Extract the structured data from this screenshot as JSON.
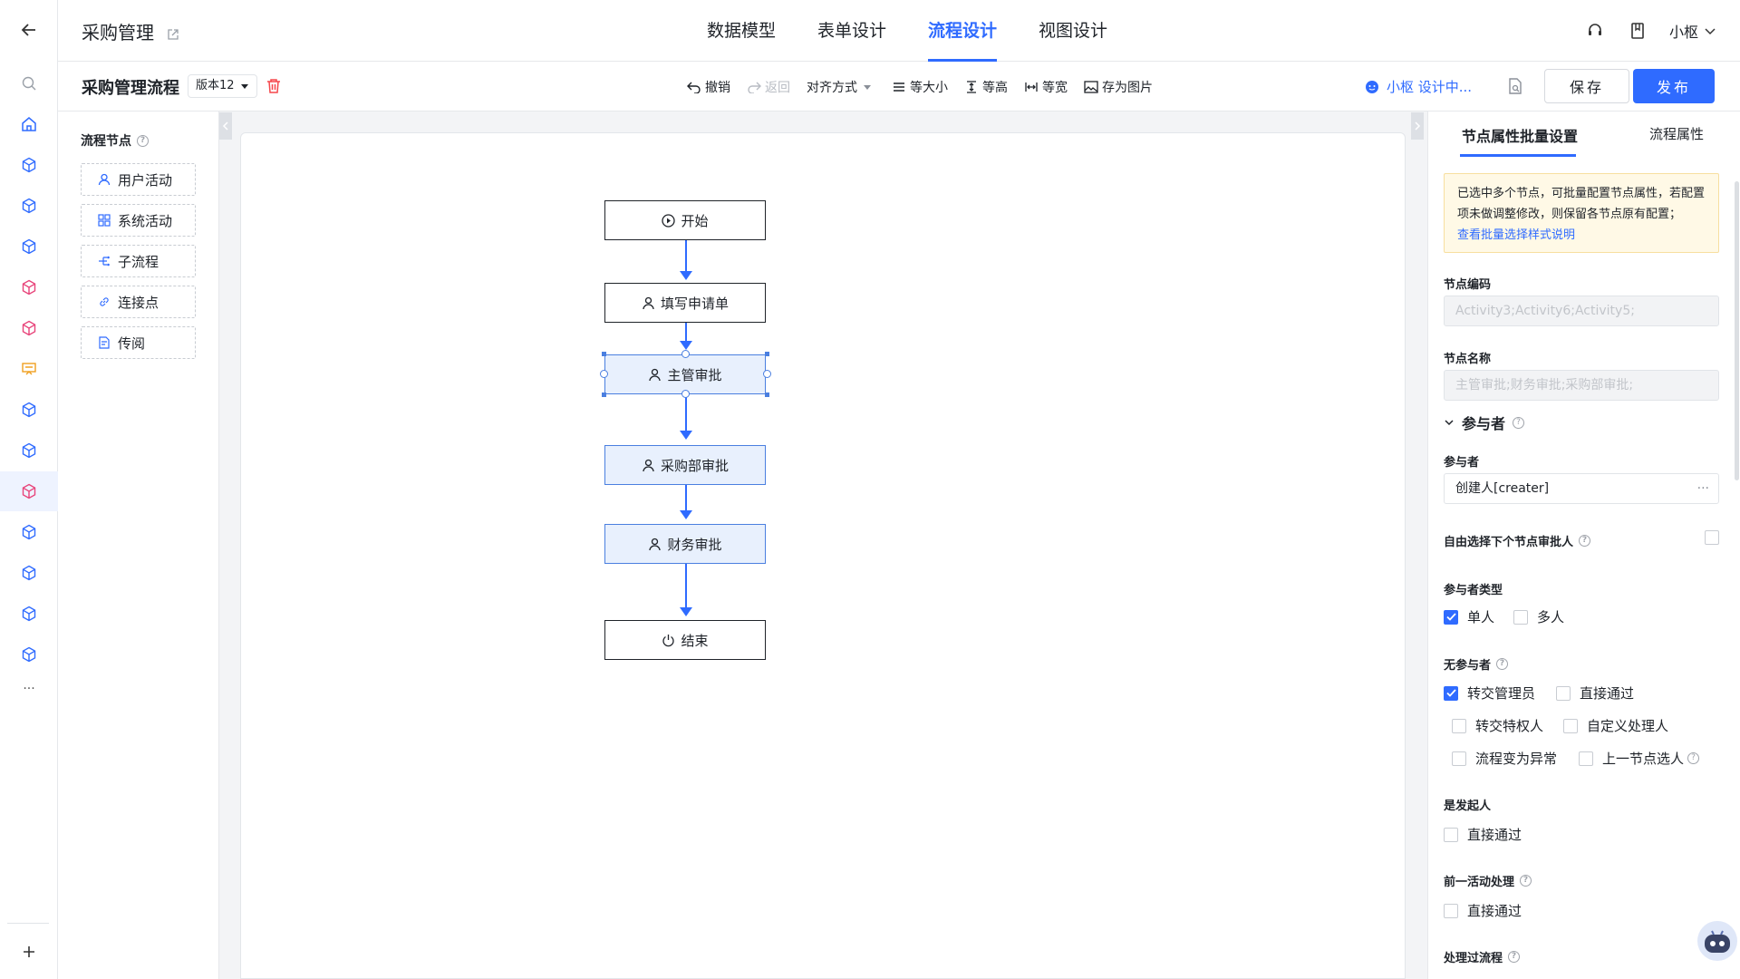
{
  "app": {
    "title": "采购管理"
  },
  "nav_tabs": [
    {
      "label": "数据模型"
    },
    {
      "label": "表单设计"
    },
    {
      "label": "流程设计"
    },
    {
      "label": "视图设计"
    }
  ],
  "user": {
    "name": "小枢"
  },
  "toolbar": {
    "process_name": "采购管理流程",
    "version": "版本12",
    "undo": "撤销",
    "redo": "返回",
    "align": "对齐方式",
    "same_size": "等大小",
    "same_height": "等高",
    "same_width": "等宽",
    "save_image": "存为图片",
    "assistant": "小枢 设计中...",
    "save": "保存",
    "publish": "发布"
  },
  "nodes_panel": {
    "title": "流程节点",
    "items": [
      {
        "label": "用户活动",
        "icon": "user-icon"
      },
      {
        "label": "系统活动",
        "icon": "grid-icon"
      },
      {
        "label": "子流程",
        "icon": "subflow-icon"
      },
      {
        "label": "连接点",
        "icon": "link-icon"
      },
      {
        "label": "传阅",
        "icon": "document-icon"
      }
    ]
  },
  "flow": {
    "nodes": [
      {
        "label": "开始",
        "icon": "play-icon",
        "selected": false
      },
      {
        "label": "填写申请单",
        "icon": "user-icon",
        "selected": false
      },
      {
        "label": "主管审批",
        "icon": "user-icon",
        "selected": true
      },
      {
        "label": "采购部审批",
        "icon": "user-icon",
        "selected": true
      },
      {
        "label": "财务审批",
        "icon": "user-icon",
        "selected": true
      },
      {
        "label": "结束",
        "icon": "power-icon",
        "selected": false
      }
    ]
  },
  "right_panel": {
    "tabs": [
      {
        "label": "节点属性批量设置"
      },
      {
        "label": "流程属性"
      }
    ],
    "notice": {
      "text": "已选中多个节点，可批量配置节点属性，若配置项未做调整修改，则保留各节点原有配置；",
      "link": "查看批量选择样式说明"
    },
    "node_code_label": "节点编码",
    "node_code_value": "Activity3;Activity6;Activity5;",
    "node_name_label": "节点名称",
    "node_name_value": "主管审批;财务审批;采购部审批;",
    "participants_section": "参与者",
    "participant_label": "参与者",
    "participant_value": "创建人[creater]",
    "free_select_label": "自由选择下个节点审批人",
    "participant_type_label": "参与者类型",
    "participant_type_options": [
      {
        "label": "单人",
        "checked": true
      },
      {
        "label": "多人",
        "checked": false
      }
    ],
    "no_participant_label": "无参与者",
    "no_participant_options": [
      {
        "label": "转交管理员",
        "checked": true
      },
      {
        "label": "直接通过",
        "checked": false
      },
      {
        "label": "转交特权人",
        "checked": false
      },
      {
        "label": "自定义处理人",
        "checked": false
      },
      {
        "label": "流程变为异常",
        "checked": false
      },
      {
        "label": "上一节点选人",
        "checked": false
      }
    ],
    "is_initiator_label": "是发起人",
    "is_initiator_option": "直接通过",
    "prev_activity_label": "前一活动处理",
    "prev_activity_option": "直接通过",
    "processed_flow_label": "处理过流程"
  },
  "colors": {
    "accent": "#2f6bff",
    "selected_node_bg": "#e8f0fd",
    "danger": "#f5474b",
    "notice_bg": "#fff9e6"
  }
}
